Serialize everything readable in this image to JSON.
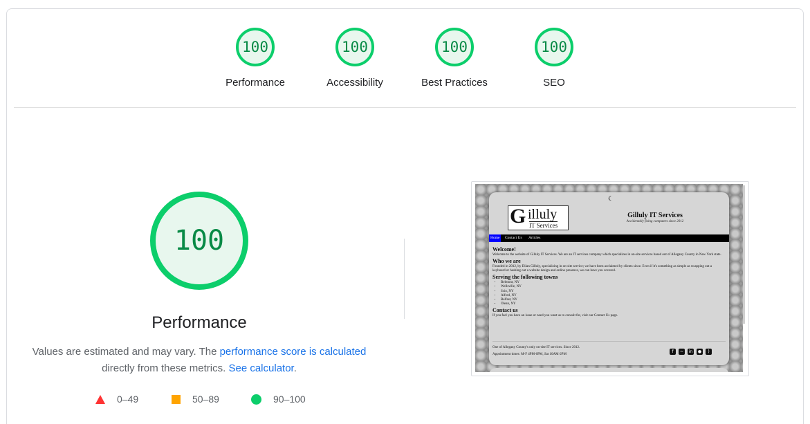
{
  "categories": [
    {
      "score": "100",
      "label": "Performance"
    },
    {
      "score": "100",
      "label": "Accessibility"
    },
    {
      "score": "100",
      "label": "Best Practices"
    },
    {
      "score": "100",
      "label": "SEO"
    }
  ],
  "performance": {
    "score": "100",
    "title": "Performance",
    "desc_prefix": "Values are estimated and may vary. The ",
    "desc_link": "performance score is calculated",
    "desc_middle": " directly from these metrics. ",
    "calc_link": "See calculator",
    "desc_suffix": "."
  },
  "legend": [
    {
      "icon": "fail-triangle-icon",
      "label": "0–49",
      "color": "#ff3333"
    },
    {
      "icon": "average-square-icon",
      "label": "50–89",
      "color": "#ffa400"
    },
    {
      "icon": "pass-circle-icon",
      "label": "90–100",
      "color": "#0cce6b"
    }
  ],
  "colors": {
    "pass": "#0cce6b",
    "pass_bg": "#e8f7ee",
    "pass_text": "#088a46",
    "link": "#1a73e8"
  },
  "screenshot": {
    "logo_g": "G",
    "logo_top": "illuly",
    "logo_bottom": "IT Services",
    "site_title": "Gilluly IT Services",
    "tagline": "Accidentally fixing computers since 2012",
    "nav": [
      "Home",
      "Contact Us",
      "Articles"
    ],
    "welcome_h": "Welcome!",
    "welcome_p": "Welcome to the website of Gilluly IT Services. We are an IT services company which specializes in on-site services based out of Allegany County in New York state.",
    "who_h": "Who we are",
    "who_p": "Founded in 2012, by Dilan Gilluly, specializing in on-site service; we have been acclaimed by clients since. Even if it's something as simple as swapping out a keyboard or hashing out a website design and online presence, we can have you covered.",
    "serving_h": "Serving the following towns",
    "towns": [
      "Belmont, NY",
      "Wellsville, NY",
      "Scio, NY",
      "Alfred, NY",
      "Belfast, NY",
      "Olean, NY"
    ],
    "contact_h": "Contact us",
    "contact_p": "If you feel you have an issue or need you want us to consult for, visit our Contact Us page.",
    "footer1": "One of Allegany County's only on-site IT services. Since 2012.",
    "footer2": "Appointment times: M-F 4PM-6PM, Sat 10AM-2PM",
    "social_icons": [
      "facebook-icon",
      "messenger-icon",
      "linkedin-icon",
      "github-icon",
      "rss-icon"
    ]
  }
}
